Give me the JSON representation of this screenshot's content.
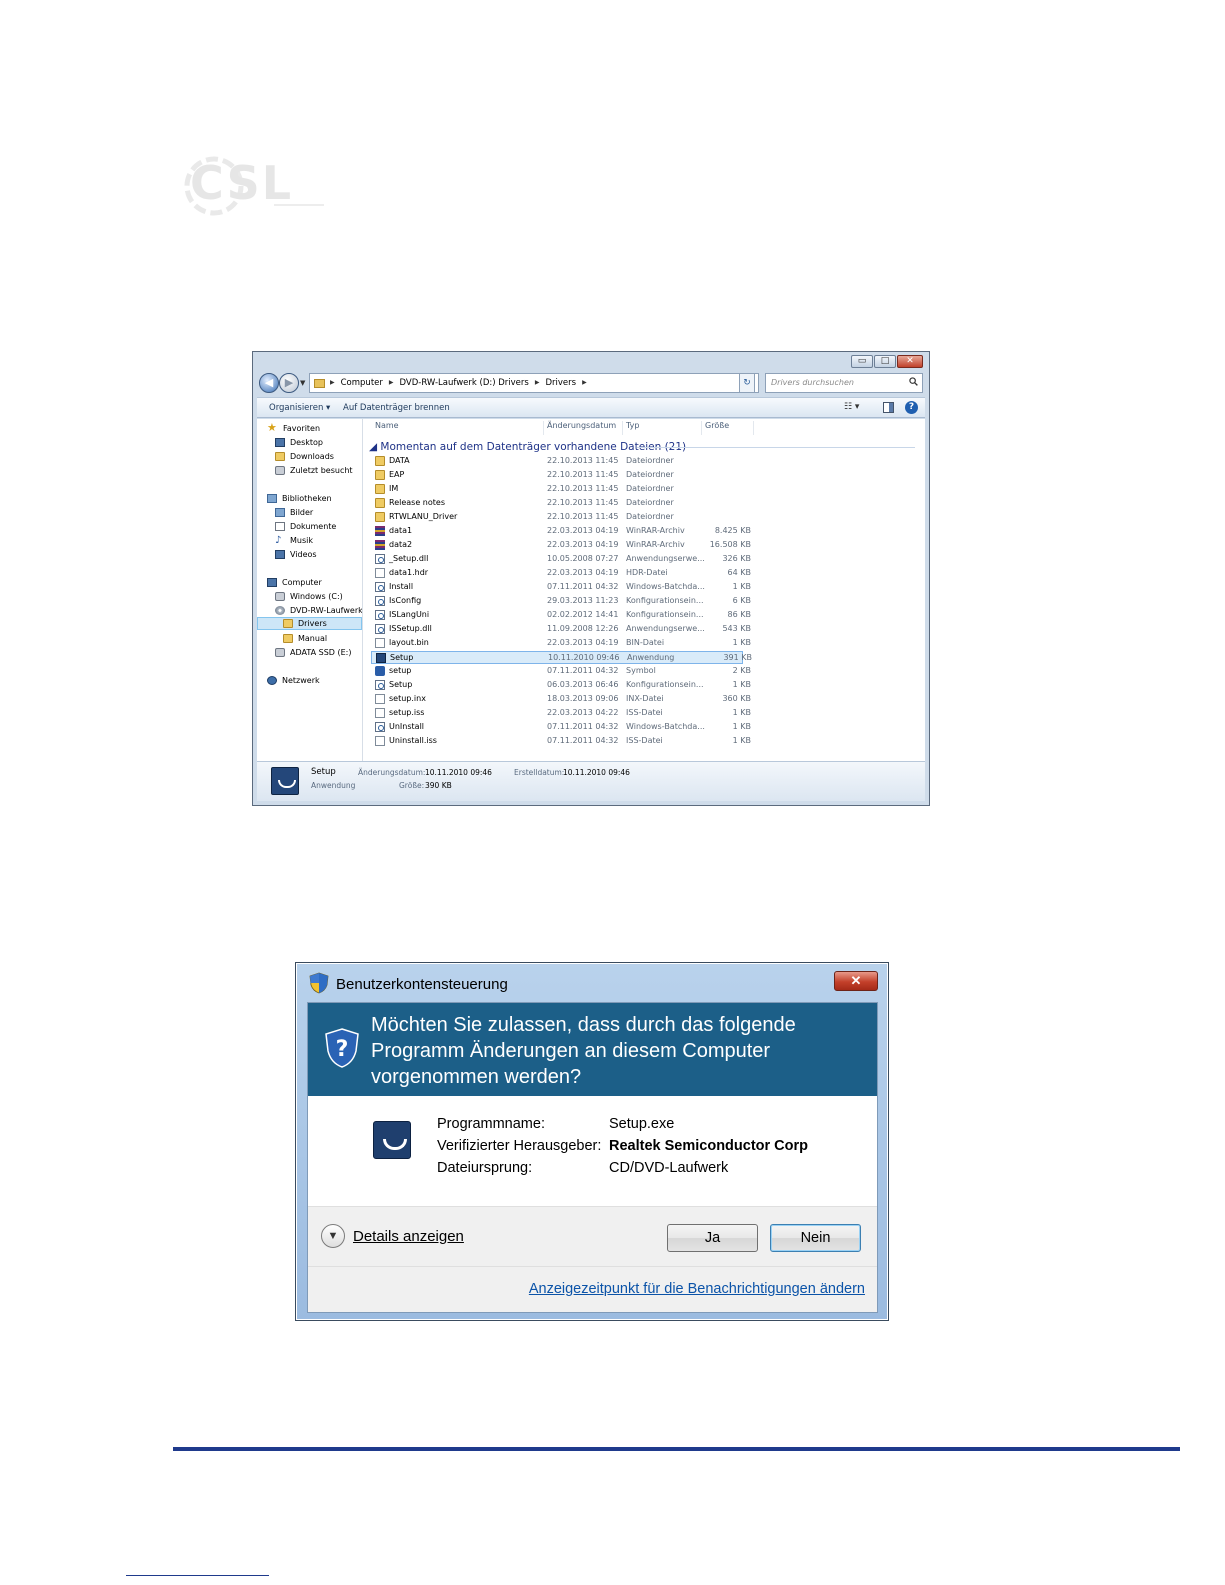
{
  "logo": {
    "text": "CSL"
  },
  "explorer": {
    "window_controls": {
      "minimize": "▭",
      "maximize": "□",
      "close": "✕"
    },
    "address": {
      "crumbs": [
        "Computer",
        "DVD-RW-Laufwerk (D:) Drivers",
        "Drivers"
      ],
      "search_placeholder": "Drivers durchsuchen"
    },
    "toolbar": {
      "organize": "Organisieren ▾",
      "burn": "Auf Datenträger brennen",
      "view": "☷ ▾"
    },
    "nav": {
      "items": [
        {
          "label": "Favoriten",
          "icon": "star-icon"
        },
        {
          "label": "Desktop",
          "icon": "desktop-icon"
        },
        {
          "label": "Downloads",
          "icon": "downloads-icon"
        },
        {
          "label": "Zuletzt besucht",
          "icon": "recent-places-icon"
        },
        {
          "label": "Bibliotheken",
          "icon": "library-icon"
        },
        {
          "label": "Bilder",
          "icon": "pictures-icon"
        },
        {
          "label": "Dokumente",
          "icon": "documents-icon"
        },
        {
          "label": "Musik",
          "icon": "music-icon"
        },
        {
          "label": "Videos",
          "icon": "videos-icon"
        },
        {
          "label": "Computer",
          "icon": "computer-icon"
        },
        {
          "label": "Windows (C:)",
          "icon": "drive-icon"
        },
        {
          "label": "DVD-RW-Laufwerk (",
          "icon": "dvd-drive-icon"
        },
        {
          "label": "Drivers",
          "icon": "folder-icon",
          "selected": true
        },
        {
          "label": "Manual",
          "icon": "folder-icon"
        },
        {
          "label": "ADATA SSD (E:)",
          "icon": "drive-icon"
        },
        {
          "label": "Netzwerk",
          "icon": "network-icon"
        }
      ]
    },
    "columns": {
      "name": "Name",
      "date": "Änderungsdatum",
      "type": "Typ",
      "size": "Größe"
    },
    "group_title": "Momentan auf dem Datenträger vorhandene Dateien (21)",
    "files": [
      {
        "name": "DATA",
        "date": "22.10.2013 11:45",
        "type": "Dateiordner",
        "size": "",
        "icon": "folder"
      },
      {
        "name": "EAP",
        "date": "22.10.2013 11:45",
        "type": "Dateiordner",
        "size": "",
        "icon": "folder"
      },
      {
        "name": "IM",
        "date": "22.10.2013 11:45",
        "type": "Dateiordner",
        "size": "",
        "icon": "folder"
      },
      {
        "name": "Release notes",
        "date": "22.10.2013 11:45",
        "type": "Dateiordner",
        "size": "",
        "icon": "folder"
      },
      {
        "name": "RTWLANU_Driver",
        "date": "22.10.2013 11:45",
        "type": "Dateiordner",
        "size": "",
        "icon": "folder"
      },
      {
        "name": "data1",
        "date": "22.03.2013 04:19",
        "type": "WinRAR-Archiv",
        "size": "8.425 KB",
        "icon": "rar"
      },
      {
        "name": "data2",
        "date": "22.03.2013 04:19",
        "type": "WinRAR-Archiv",
        "size": "16.508 KB",
        "icon": "rar"
      },
      {
        "name": "_Setup.dll",
        "date": "10.05.2008 07:27",
        "type": "Anwendungserwe...",
        "size": "326 KB",
        "icon": "gear"
      },
      {
        "name": "data1.hdr",
        "date": "22.03.2013 04:19",
        "type": "HDR-Datei",
        "size": "64 KB",
        "icon": "page"
      },
      {
        "name": "Install",
        "date": "07.11.2011 04:32",
        "type": "Windows-Batchda...",
        "size": "1 KB",
        "icon": "gear"
      },
      {
        "name": "IsConfig",
        "date": "29.03.2013 11:23",
        "type": "Konfigurationsein...",
        "size": "6 KB",
        "icon": "gear"
      },
      {
        "name": "ISLangUni",
        "date": "02.02.2012 14:41",
        "type": "Konfigurationsein...",
        "size": "86 KB",
        "icon": "gear"
      },
      {
        "name": "ISSetup.dll",
        "date": "11.09.2008 12:26",
        "type": "Anwendungserwe...",
        "size": "543 KB",
        "icon": "gear"
      },
      {
        "name": "layout.bin",
        "date": "22.03.2013 04:19",
        "type": "BIN-Datei",
        "size": "1 KB",
        "icon": "page"
      },
      {
        "name": "Setup",
        "date": "10.11.2010 09:46",
        "type": "Anwendung",
        "size": "391 KB",
        "icon": "app",
        "selected": true
      },
      {
        "name": "setup",
        "date": "07.11.2011 04:32",
        "type": "Symbol",
        "size": "2 KB",
        "icon": "sym"
      },
      {
        "name": "Setup",
        "date": "06.03.2013 06:46",
        "type": "Konfigurationsein...",
        "size": "1 KB",
        "icon": "gear"
      },
      {
        "name": "setup.inx",
        "date": "18.03.2013 09:06",
        "type": "INX-Datei",
        "size": "360 KB",
        "icon": "page"
      },
      {
        "name": "setup.iss",
        "date": "22.03.2013 04:22",
        "type": "ISS-Datei",
        "size": "1 KB",
        "icon": "page"
      },
      {
        "name": "UnInstall",
        "date": "07.11.2011 04:32",
        "type": "Windows-Batchda...",
        "size": "1 KB",
        "icon": "gear"
      },
      {
        "name": "Uninstall.iss",
        "date": "07.11.2011 04:32",
        "type": "ISS-Datei",
        "size": "1 KB",
        "icon": "page"
      }
    ],
    "details": {
      "name": "Setup",
      "kind": "Anwendung",
      "modified_label": "Änderungsdatum:",
      "modified": "10.11.2010 09:46",
      "created_label": "Erstelldatum:",
      "created": "10.11.2010 09:46",
      "size_label": "Größe:",
      "size": "390 KB"
    }
  },
  "uac": {
    "title": "Benutzerkontensteuerung",
    "close": "✕",
    "question": "Möchten Sie zulassen, dass durch das folgende Programm Änderungen an diesem Computer vorgenommen werden?",
    "program_label": "Programmname:",
    "program": "Setup.exe",
    "publisher_label": "Verifizierter Herausgeber:",
    "publisher": "Realtek Semiconductor Corp",
    "origin_label": "Dateiursprung:",
    "origin": "CD/DVD-Laufwerk",
    "details": "Details anzeigen",
    "yes": "Ja",
    "no": "Nein",
    "link": "Anzeigezeitpunkt für die Benachrichtigungen ändern"
  },
  "colors": {
    "accent": "#1f3a8c",
    "uac_banner": "#1c5f88",
    "link": "#0b53a8"
  }
}
